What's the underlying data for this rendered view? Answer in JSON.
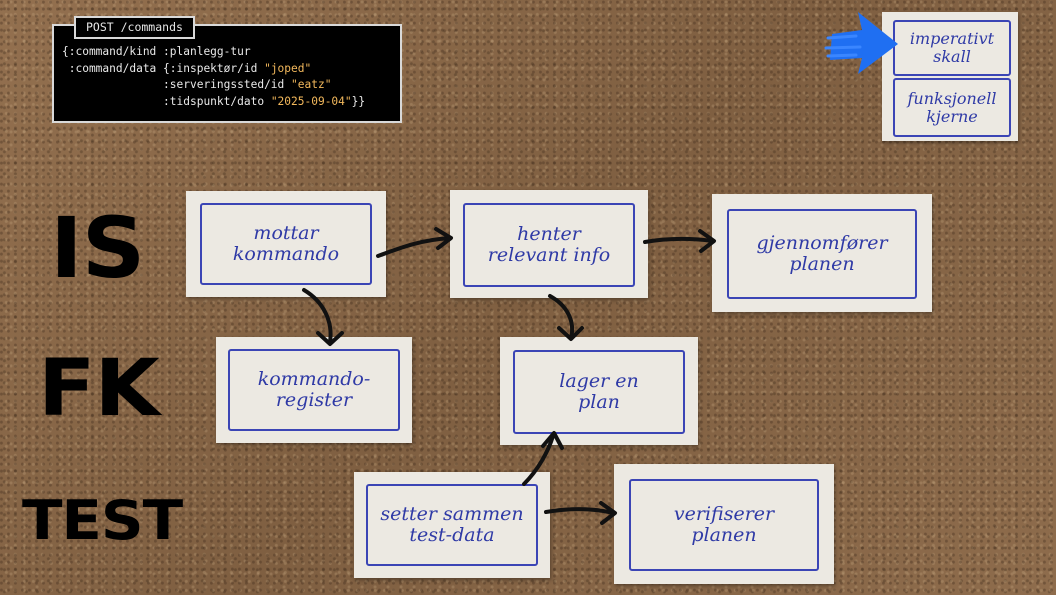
{
  "code": {
    "tab": "POST /commands",
    "lines": [
      {
        "pre": "{:command/kind :planlegg-tur",
        "str": "",
        "post": ""
      },
      {
        "pre": " :command/data {:inspektør/id ",
        "str": "\"joped\"",
        "post": ""
      },
      {
        "pre": "               :serveringssted/id ",
        "str": "\"eatz\"",
        "post": ""
      },
      {
        "pre": "               :tidspunkt/dato ",
        "str": "\"2025-09-04\"",
        "post": "}}"
      }
    ]
  },
  "side_labels": {
    "is": "IS",
    "fk": "FK",
    "test": "TEST"
  },
  "legend": {
    "imperative_shell": "imperativt\nskall",
    "functional_core": "funksjonell\nkjerne"
  },
  "cards": {
    "receives_command": "mottar\nkommando",
    "fetches_info": "henter\nrelevant info",
    "executes_plan": "gjennomfører\nplanen",
    "command_register": "kommando-\nregister",
    "creates_plan": "lager en\nplan",
    "assembles_test_data": "setter sammen\ntest-data",
    "verifies_plan": "verifiserer\nplanen"
  },
  "colors": {
    "ink": "#2f3aa6",
    "card": "#ece9e2",
    "accent_arrow": "#1f6ff2",
    "string": "#f2b85c"
  }
}
